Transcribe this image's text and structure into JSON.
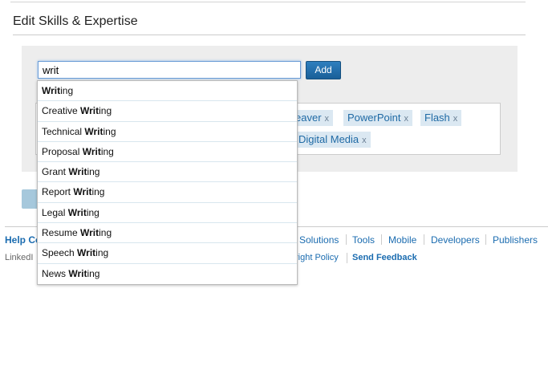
{
  "page": {
    "title": "Edit Skills & Expertise"
  },
  "skill_input": {
    "value": "writ"
  },
  "add_button": {
    "label": "Add"
  },
  "tags": [
    {
      "label": "eaver",
      "remove": "x"
    },
    {
      "label": "PowerPoint",
      "remove": "x"
    },
    {
      "label": "Flash",
      "remove": "x"
    },
    {
      "label": "Digital Media",
      "remove": "x"
    }
  ],
  "suggestions": [
    {
      "before": "",
      "match": "Writ",
      "after": "ing"
    },
    {
      "before": "Creative ",
      "match": "Writ",
      "after": "ing"
    },
    {
      "before": "Technical ",
      "match": "Writ",
      "after": "ing"
    },
    {
      "before": "Proposal ",
      "match": "Writ",
      "after": "ing"
    },
    {
      "before": "Grant ",
      "match": "Writ",
      "after": "ing"
    },
    {
      "before": "Report ",
      "match": "Writ",
      "after": "ing"
    },
    {
      "before": "Legal ",
      "match": "Writ",
      "after": "ing"
    },
    {
      "before": "Resume ",
      "match": "Writ",
      "after": "ing"
    },
    {
      "before": "Speech ",
      "match": "Writ",
      "after": "ing"
    },
    {
      "before": "News ",
      "match": "Writ",
      "after": "ing"
    }
  ],
  "footer": {
    "help_partial": "Help Co",
    "links": [
      "Solutions",
      "Tools",
      "Mobile",
      "Developers",
      "Publishers"
    ],
    "linkedin_partial": "LinkedI",
    "copyright_partial": "right Policy",
    "send_feedback": "Send Feedback"
  },
  "colors": {
    "link": "#1b6cb0",
    "tag_bg": "#dbe8f2",
    "button": "#1f6aa5",
    "panel": "#ededed"
  }
}
